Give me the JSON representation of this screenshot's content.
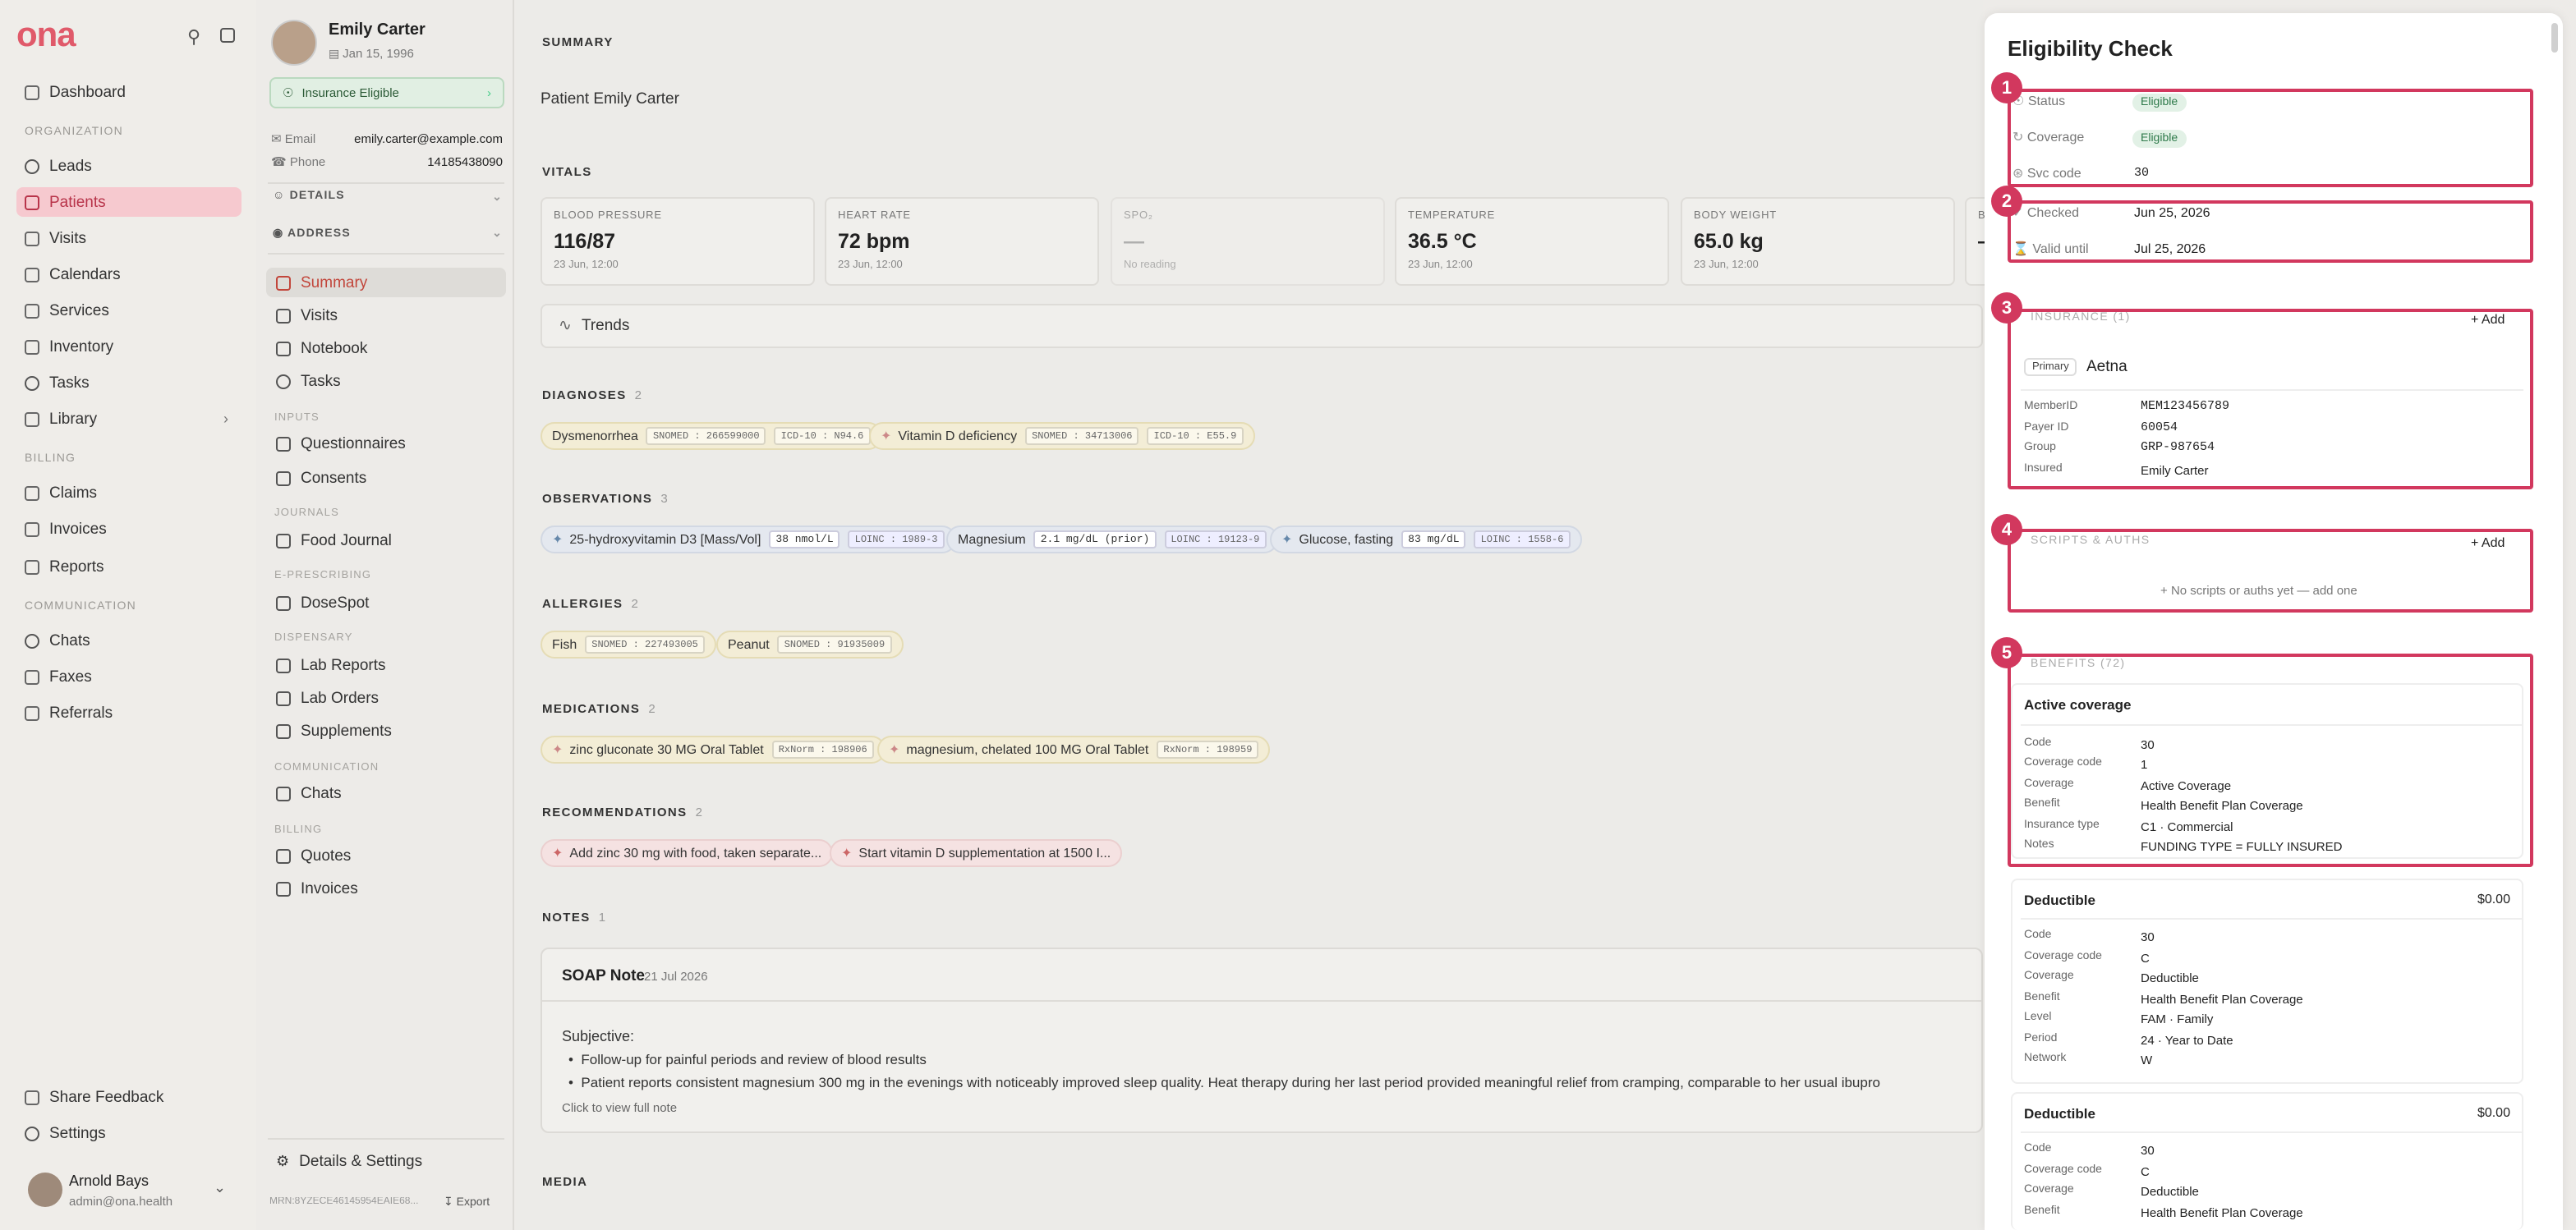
{
  "app": {
    "logo": "ona"
  },
  "nav": {
    "dashboard": "Dashboard",
    "sec_org": "ORGANIZATION",
    "leads": "Leads",
    "patients": "Patients",
    "visits": "Visits",
    "calendars": "Calendars",
    "services": "Services",
    "inventory": "Inventory",
    "tasks": "Tasks",
    "library": "Library",
    "sec_billing": "BILLING",
    "claims": "Claims",
    "invoices": "Invoices",
    "reports": "Reports",
    "sec_comm": "COMMUNICATION",
    "chats": "Chats",
    "faxes": "Faxes",
    "referrals": "Referrals",
    "share_feedback": "Share Feedback",
    "settings": "Settings"
  },
  "user": {
    "name": "Arnold Bays",
    "email": "admin@ona.health"
  },
  "patient": {
    "name": "Emily Carter",
    "dob": "Jan 15, 1996",
    "status": "Insurance Eligible",
    "email_label": "Email",
    "email": "emily.carter@example.com",
    "phone_label": "Phone",
    "phone": "14185438090",
    "details": "DETAILS",
    "address": "ADDRESS",
    "menu": {
      "summary": "Summary",
      "visits": "Visits",
      "notebook": "Notebook",
      "tasks": "Tasks",
      "sec_inputs": "INPUTS",
      "questionnaires": "Questionnaires",
      "consents": "Consents",
      "sec_journals": "JOURNALS",
      "food_journal": "Food Journal",
      "sec_erx": "E-PRESCRIBING",
      "dosespot": "DoseSpot",
      "sec_dispensary": "DISPENSARY",
      "lab_reports": "Lab Reports",
      "lab_orders": "Lab Orders",
      "supplements": "Supplements",
      "sec_comm": "COMMUNICATION",
      "chats": "Chats",
      "sec_billing": "BILLING",
      "quotes": "Quotes",
      "invoices": "Invoices",
      "details_settings": "Details & Settings"
    },
    "mrn": "MRN:8YZECE46145954EAIE68...",
    "export": "Export"
  },
  "main": {
    "summary_title": "SUMMARY",
    "summary_text": "Patient Emily Carter",
    "vitals_title": "VITALS",
    "vitals": [
      {
        "label": "BLOOD PRESSURE",
        "value": "116/87",
        "time": "23 Jun, 12:00"
      },
      {
        "label": "HEART RATE",
        "value": "72 bpm",
        "time": "23 Jun, 12:00"
      },
      {
        "label": "SPO₂",
        "value": "—",
        "time": "No reading"
      },
      {
        "label": "TEMPERATURE",
        "value": "36.5 °C",
        "time": "23 Jun, 12:00"
      },
      {
        "label": "BODY WEIGHT",
        "value": "65.0 kg",
        "time": "23 Jun, 12:00"
      },
      {
        "label": "B",
        "value": "—",
        "time": ""
      }
    ],
    "trends": "Trends",
    "diagnoses_title": "DIAGNOSES",
    "diagnoses_count": "2",
    "diagnoses": [
      {
        "name": "Dysmenorrhea",
        "c1": "SNOMED : 266599000",
        "c2": "ICD-10 : N94.6"
      },
      {
        "name": "Vitamin D deficiency",
        "c1": "SNOMED : 34713006",
        "c2": "ICD-10 : E55.9"
      }
    ],
    "observations_title": "OBSERVATIONS",
    "observations_count": "3",
    "observations": [
      {
        "name": "25-hydroxyvitamin D3 [Mass/Vol]",
        "val": "38 nmol/L",
        "code": "LOINC : 1989-3"
      },
      {
        "name": "Magnesium",
        "val": "2.1 mg/dL (prior)",
        "code": "LOINC : 19123-9"
      },
      {
        "name": "Glucose, fasting",
        "val": "83 mg/dL",
        "code": "LOINC : 1558-6"
      }
    ],
    "allergies_title": "ALLERGIES",
    "allergies_count": "2",
    "allergies": [
      {
        "name": "Fish",
        "code": "SNOMED : 227493005"
      },
      {
        "name": "Peanut",
        "code": "SNOMED : 91935009"
      }
    ],
    "medications_title": "MEDICATIONS",
    "medications_count": "2",
    "medications": [
      {
        "name": "zinc gluconate 30 MG Oral Tablet",
        "code": "RxNorm : 198906"
      },
      {
        "name": "magnesium, chelated 100 MG Oral Tablet",
        "code": "RxNorm : 198959"
      }
    ],
    "recs_title": "RECOMMENDATIONS",
    "recs_count": "2",
    "recs": [
      "Add zinc 30 mg with food, taken separate...",
      "Start vitamin D supplementation at 1500 I..."
    ],
    "notes_title": "NOTES",
    "notes_count": "1",
    "note": {
      "title": "SOAP Note",
      "date": "21 Jul 2026",
      "subjective": "Subjective:",
      "b1": "Follow-up for painful periods and review of blood results",
      "b2": "Patient reports consistent magnesium 300 mg in the evenings with noticeably improved sleep quality. Heat therapy during her last period provided meaningful relief from cramping, comparable to her usual ibupro",
      "view": "Click to view full note"
    },
    "media_title": "MEDIA"
  },
  "panel": {
    "title": "Eligibility Check",
    "status_label": "Status",
    "status": "Eligible",
    "coverage_label": "Coverage",
    "coverage": "Eligible",
    "svc_label": "Svc code",
    "svc": "30",
    "checked_label": "Checked",
    "checked": "Jun 25, 2026",
    "valid_label": "Valid until",
    "valid": "Jul 25, 2026",
    "insurance_title": "INSURANCE",
    "insurance_count": "(1)",
    "add": "Add",
    "primary": "Primary",
    "insurer": "Aetna",
    "ins_fields": [
      {
        "k": "MemberID",
        "v": "MEM123456789"
      },
      {
        "k": "Payer ID",
        "v": "60054"
      },
      {
        "k": "Group",
        "v": "GRP-987654"
      },
      {
        "k": "Insured",
        "v": "Emily Carter"
      }
    ],
    "scripts_title": "SCRIPTS & AUTHS",
    "scripts_empty": "No scripts or auths yet — add one",
    "benefits_title": "BENEFITS (72)",
    "b1": {
      "title": "Active coverage",
      "rows": [
        {
          "k": "Code",
          "v": "30"
        },
        {
          "k": "Coverage code",
          "v": "1"
        },
        {
          "k": "Coverage",
          "v": "Active Coverage"
        },
        {
          "k": "Benefit",
          "v": "Health Benefit Plan Coverage"
        },
        {
          "k": "Insurance type",
          "v": "C1 · Commercial"
        },
        {
          "k": "Notes",
          "v": "FUNDING TYPE = FULLY INSURED"
        }
      ]
    },
    "b2": {
      "title": "Deductible",
      "amount": "$0.00",
      "rows": [
        {
          "k": "Code",
          "v": "30"
        },
        {
          "k": "Coverage code",
          "v": "C"
        },
        {
          "k": "Coverage",
          "v": "Deductible"
        },
        {
          "k": "Benefit",
          "v": "Health Benefit Plan Coverage"
        },
        {
          "k": "Level",
          "v": "FAM · Family"
        },
        {
          "k": "Period",
          "v": "24 · Year to Date"
        },
        {
          "k": "Network",
          "v": "W"
        }
      ]
    },
    "b3": {
      "title": "Deductible",
      "amount": "$0.00",
      "rows": [
        {
          "k": "Code",
          "v": "30"
        },
        {
          "k": "Coverage code",
          "v": "C"
        },
        {
          "k": "Coverage",
          "v": "Deductible"
        },
        {
          "k": "Benefit",
          "v": "Health Benefit Plan Coverage"
        }
      ]
    },
    "markers": [
      "1",
      "2",
      "3",
      "4",
      "5"
    ]
  }
}
